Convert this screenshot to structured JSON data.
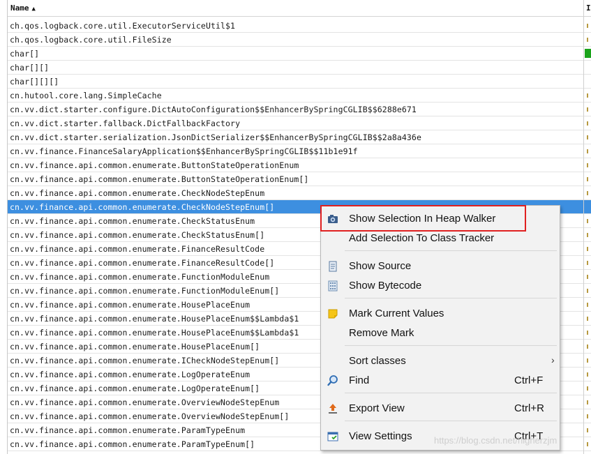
{
  "table": {
    "column_name": "Name",
    "column_right": "I",
    "sort_icon": "▲",
    "rows": [
      "ch.qos.logback.core.util.ExecutorServiceUtil$1",
      "ch.qos.logback.core.util.FileSize",
      "char[]",
      "char[][]",
      "char[][][]",
      "cn.hutool.core.lang.SimpleCache",
      "cn.vv.dict.starter.configure.DictAutoConfiguration$$EnhancerBySpringCGLIB$$6288e671",
      "cn.vv.dict.starter.fallback.DictFallbackFactory",
      "cn.vv.dict.starter.serialization.JsonDictSerializer$$EnhancerBySpringCGLIB$$2a8a436e",
      "cn.vv.finance.FinanceSalaryApplication$$EnhancerBySpringCGLIB$$11b1e91f",
      "cn.vv.finance.api.common.enumerate.ButtonStateOperationEnum",
      "cn.vv.finance.api.common.enumerate.ButtonStateOperationEnum[]",
      "cn.vv.finance.api.common.enumerate.CheckNodeStepEnum",
      "cn.vv.finance.api.common.enumerate.CheckNodeStepEnum[]",
      "cn.vv.finance.api.common.enumerate.CheckStatusEnum",
      "cn.vv.finance.api.common.enumerate.CheckStatusEnum[]",
      "cn.vv.finance.api.common.enumerate.FinanceResultCode",
      "cn.vv.finance.api.common.enumerate.FinanceResultCode[]",
      "cn.vv.finance.api.common.enumerate.FunctionModuleEnum",
      "cn.vv.finance.api.common.enumerate.FunctionModuleEnum[]",
      "cn.vv.finance.api.common.enumerate.HousePlaceEnum",
      "cn.vv.finance.api.common.enumerate.HousePlaceEnum$$Lambda$1",
      "cn.vv.finance.api.common.enumerate.HousePlaceEnum$$Lambda$1",
      "cn.vv.finance.api.common.enumerate.HousePlaceEnum[]",
      "cn.vv.finance.api.common.enumerate.ICheckNodeStepEnum[]",
      "cn.vv.finance.api.common.enumerate.LogOperateEnum",
      "cn.vv.finance.api.common.enumerate.LogOperateEnum[]",
      "cn.vv.finance.api.common.enumerate.OverviewNodeStepEnum",
      "cn.vv.finance.api.common.enumerate.OverviewNodeStepEnum[]",
      "cn.vv.finance.api.common.enumerate.ParamTypeEnum",
      "cn.vv.finance.api.common.enumerate.ParamTypeEnum[]"
    ],
    "selected_row_index": 13,
    "right_cells": [
      "1",
      "0",
      "",
      "",
      "",
      "1",
      "1",
      "1",
      "1",
      "1",
      "1",
      "1",
      "1",
      "",
      "0",
      "1",
      "1",
      "1",
      "4",
      "1",
      "1",
      "1",
      "1",
      "1",
      "1",
      "1",
      "1",
      "1",
      "1",
      "1",
      "1"
    ]
  },
  "menu": {
    "items": [
      {
        "label": "Show Selection In Heap Walker",
        "icon": "heap-walker-camera-icon",
        "accel": ""
      },
      {
        "label": "Add Selection To Class Tracker",
        "icon": "",
        "accel": ""
      },
      {
        "label": "Show Source",
        "icon": "source-document-icon",
        "accel": ""
      },
      {
        "label": "Show Bytecode",
        "icon": "bytecode-grid-icon",
        "accel": ""
      },
      {
        "label": "Mark Current Values",
        "icon": "mark-note-icon",
        "accel": ""
      },
      {
        "label": "Remove Mark",
        "icon": "",
        "accel": ""
      },
      {
        "label": "Sort classes",
        "icon": "",
        "accel": ""
      },
      {
        "label": "Find",
        "icon": "magnifier-icon",
        "accel": "Ctrl+F"
      },
      {
        "label": "Export View",
        "icon": "export-arrow-icon",
        "accel": "Ctrl+R"
      },
      {
        "label": "View Settings",
        "icon": "view-settings-icon",
        "accel": "Ctrl+T"
      }
    ],
    "submenu_arrow": "›"
  },
  "colors": {
    "selection": "#3d8fe0",
    "highlight_box": "#e02020"
  },
  "watermark": "https://blog.csdn.net/higherzjm"
}
